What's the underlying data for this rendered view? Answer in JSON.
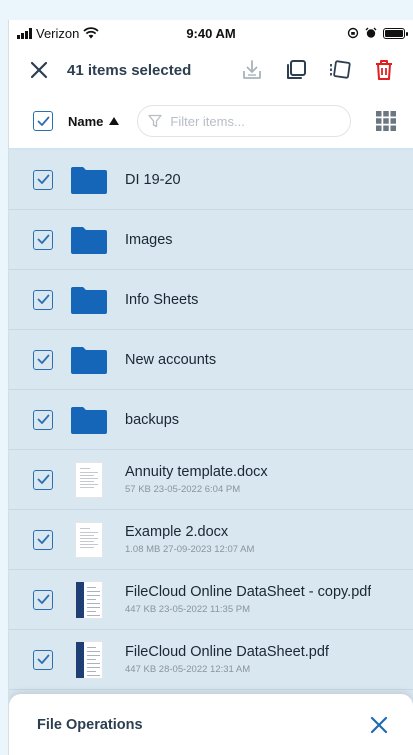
{
  "status_bar": {
    "carrier": "Verizon",
    "time": "9:40 AM"
  },
  "toolbar": {
    "selection_label": "41 items selected",
    "icons": [
      "close-icon",
      "download-icon",
      "copy-icon",
      "move-icon",
      "delete-icon"
    ],
    "delete_color": "#e02020"
  },
  "sort_bar": {
    "sort_label": "Name",
    "sort_direction": "ascending",
    "filter_placeholder": "Filter items...",
    "select_all_checked": true
  },
  "files": [
    {
      "name": "DI 19-20",
      "type": "folder",
      "checked": true,
      "meta": ""
    },
    {
      "name": "Images",
      "type": "folder",
      "checked": true,
      "meta": ""
    },
    {
      "name": "Info Sheets",
      "type": "folder",
      "checked": true,
      "meta": ""
    },
    {
      "name": "New accounts",
      "type": "folder",
      "checked": true,
      "meta": ""
    },
    {
      "name": "backups",
      "type": "folder",
      "checked": true,
      "meta": ""
    },
    {
      "name": "Annuity template.docx",
      "type": "docx",
      "checked": true,
      "meta": "57 KB 23-05-2022 6:04 PM"
    },
    {
      "name": "Example 2.docx",
      "type": "docx",
      "checked": true,
      "meta": "1.08 MB 27-09-2023 12:07 AM"
    },
    {
      "name": "FileCloud Online DataSheet - copy.pdf",
      "type": "pdf",
      "checked": true,
      "meta": "447 KB 23-05-2022 11:35 PM"
    },
    {
      "name": "FileCloud Online DataSheet.pdf",
      "type": "pdf",
      "checked": true,
      "meta": "447 KB 28-05-2022 12:31 AM"
    }
  ],
  "sheet": {
    "label": "File Operations"
  },
  "colors": {
    "accent": "#1e6bb0",
    "folder": "#1565b8",
    "list_background": "#d9e7f1"
  }
}
